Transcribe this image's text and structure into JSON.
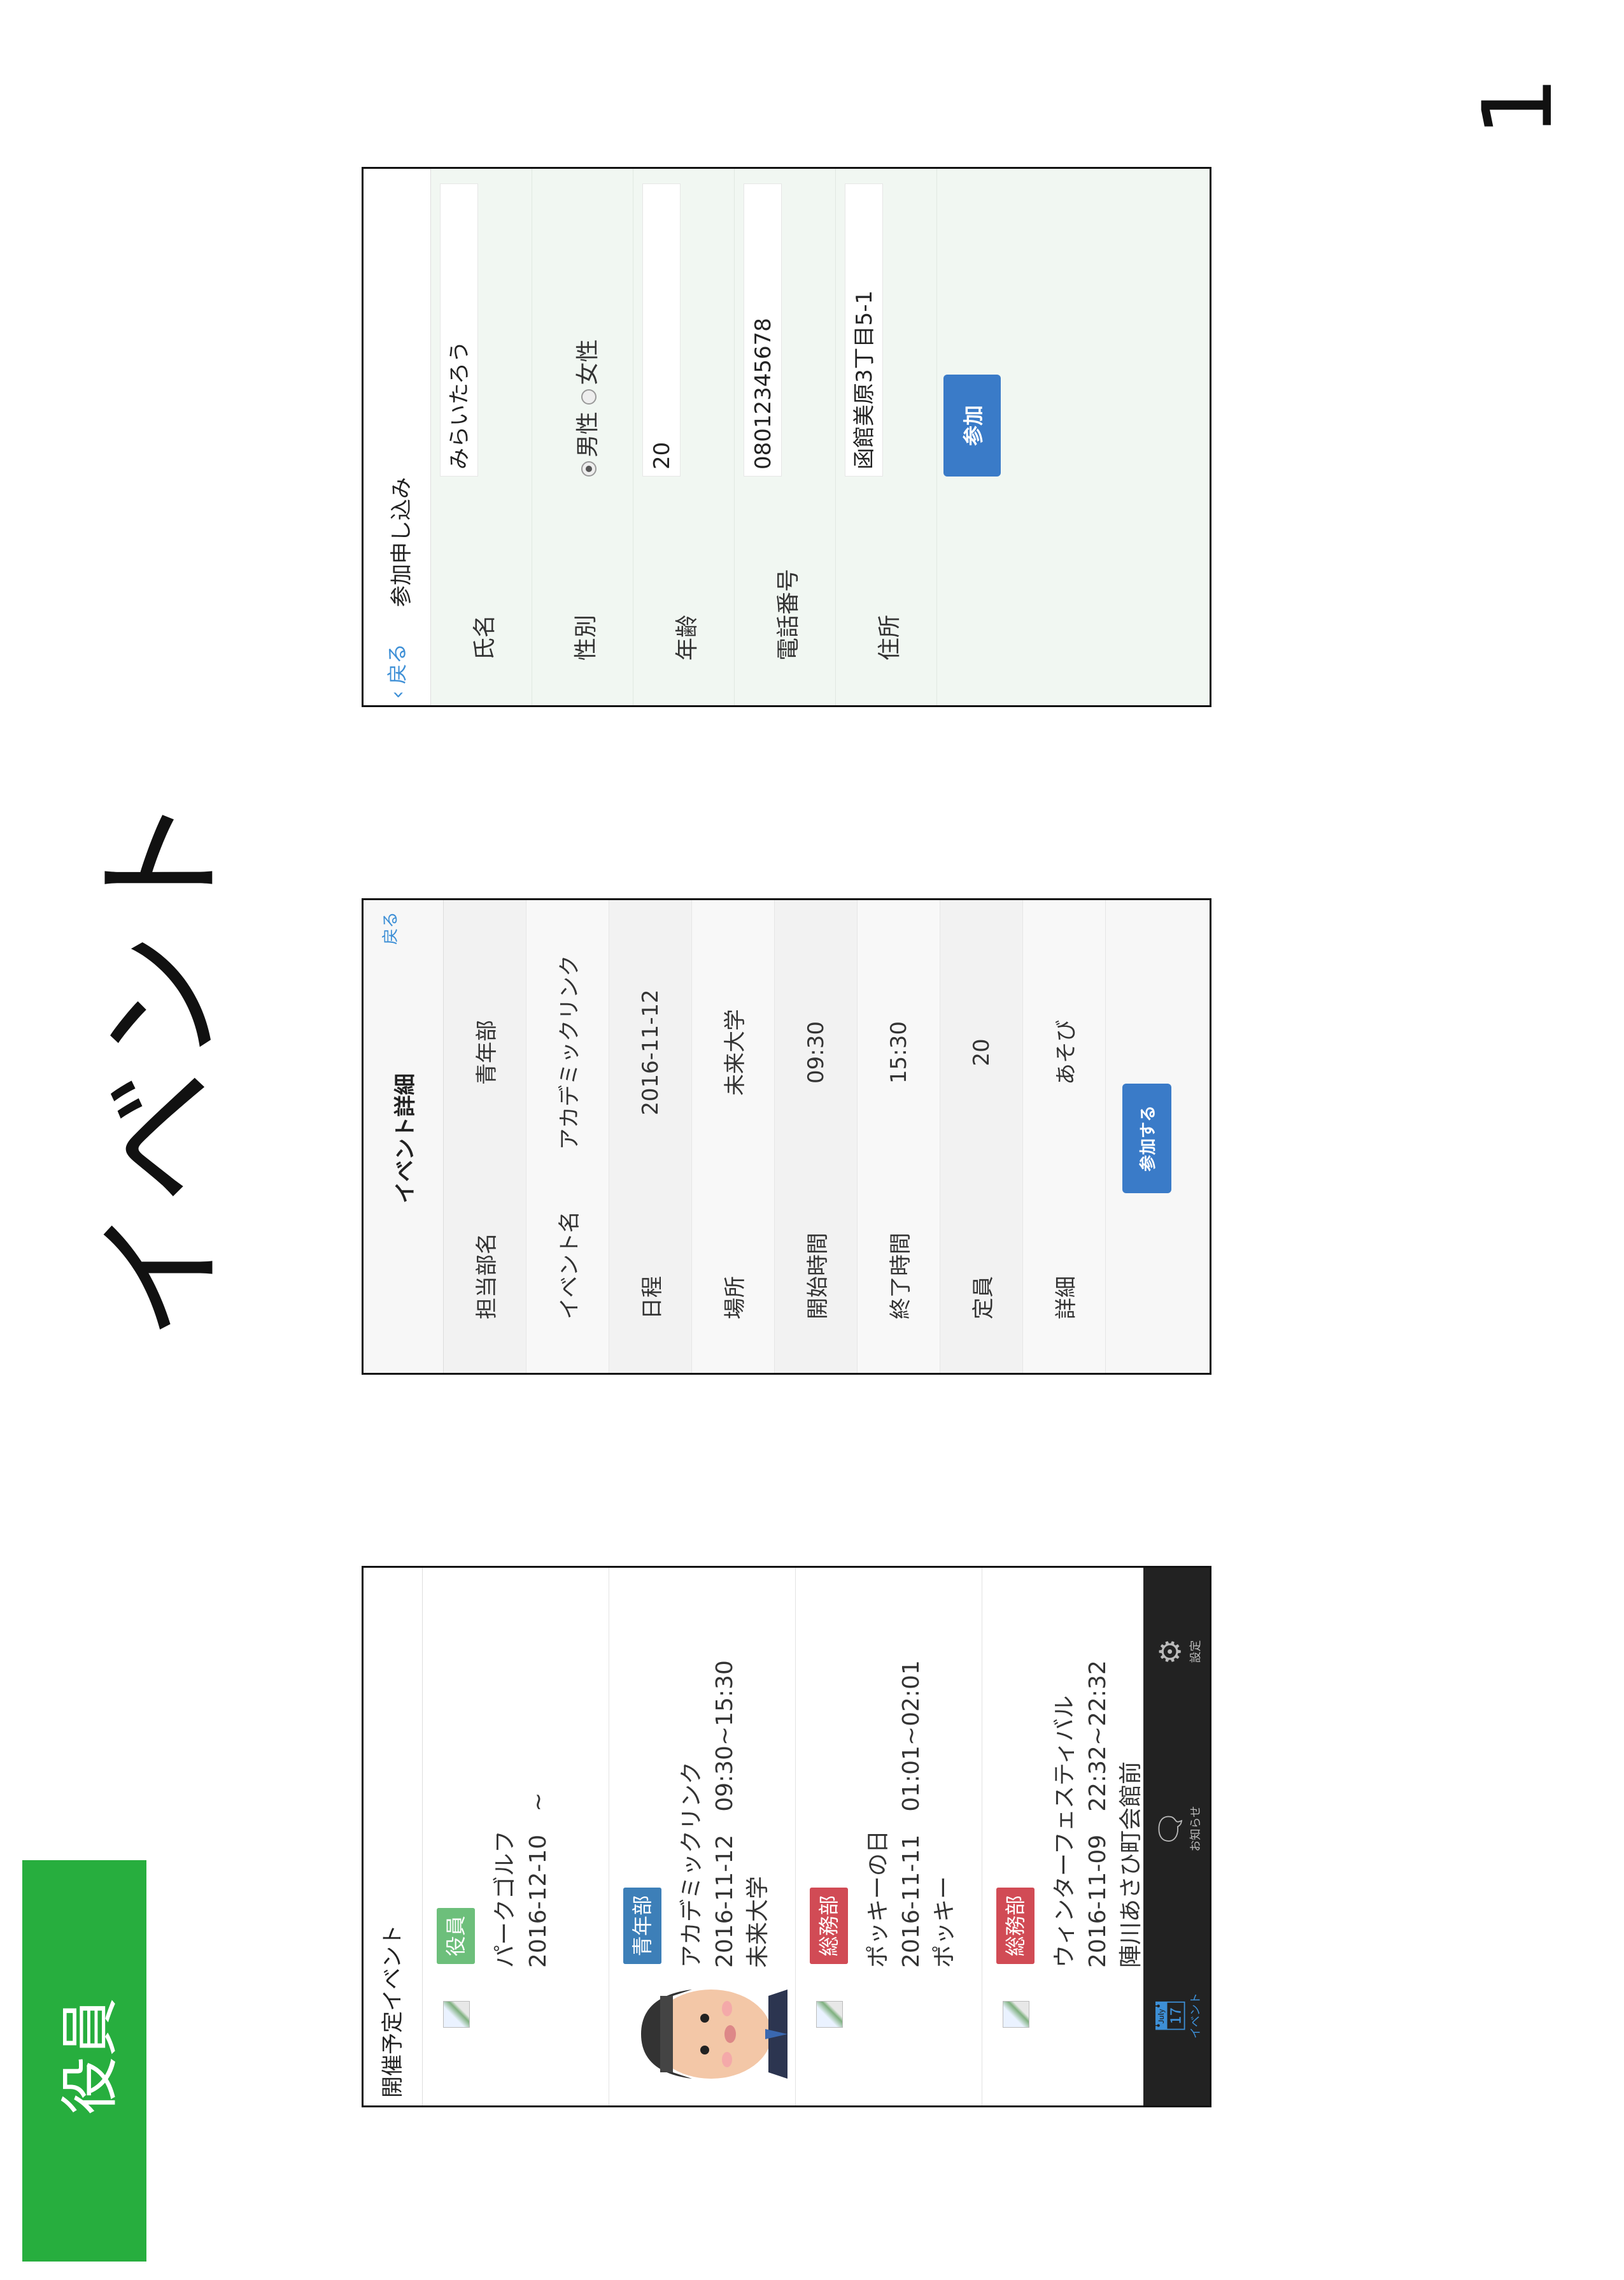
{
  "slide": {
    "role_label": "役員",
    "title": "イベント",
    "page_number": "1"
  },
  "colors": {
    "role_badge": "#27ae3e",
    "accent_blue": "#3a7bc8",
    "tag_role": "#6dbf7b",
    "tag_youth": "#3d7fb8",
    "tag_general": "#d14b55"
  },
  "list_screen": {
    "header": "開催予定イベント",
    "items": [
      {
        "tag": "役員",
        "tag_color": "#6dbf7b",
        "name": "パークゴルフ",
        "schedule": "2016-12-10　~",
        "place": "",
        "has_avatar": false
      },
      {
        "tag": "青年部",
        "tag_color": "#3d7fb8",
        "name": "アカデミックリンク",
        "schedule": "2016-11-12　09:30~15:30",
        "place": "未来大学",
        "has_avatar": true
      },
      {
        "tag": "総務部",
        "tag_color": "#d14b55",
        "name": "ポッキーの日",
        "schedule": "2016-11-11　01:01~02:01",
        "place": "ポッキー",
        "has_avatar": false
      },
      {
        "tag": "総務部",
        "tag_color": "#d14b55",
        "name": "ウィンターフェスティバル",
        "schedule": "2016-11-09　22:32~22:32",
        "place": "陣川あさひ町会館前",
        "has_avatar": false
      }
    ],
    "tabs": [
      {
        "icon": "calendar-icon",
        "label": "イベント",
        "active": true
      },
      {
        "icon": "chat-icon",
        "label": "お知らせ",
        "active": false
      },
      {
        "icon": "gear-icon",
        "label": "設定",
        "active": false
      }
    ]
  },
  "detail_screen": {
    "title": "イベント詳細",
    "back": "戻る",
    "rows": [
      {
        "label": "担当部名",
        "value": "青年部"
      },
      {
        "label": "イベント名",
        "value": "アカデミックリンク"
      },
      {
        "label": "日程",
        "value": "2016-11-12"
      },
      {
        "label": "場所",
        "value": "未来大学"
      },
      {
        "label": "開始時間",
        "value": "09:30"
      },
      {
        "label": "終了時間",
        "value": "15:30"
      },
      {
        "label": "定員",
        "value": "20"
      },
      {
        "label": "詳細",
        "value": "あそび"
      }
    ],
    "join_button": "参加する"
  },
  "form_screen": {
    "back": "戻る",
    "title": "参加申し込み",
    "fields": {
      "name": {
        "label": "氏名",
        "value": "みらいたろう"
      },
      "gender": {
        "label": "性別",
        "options": [
          "男性",
          "女性"
        ],
        "selected": "男性"
      },
      "age": {
        "label": "年齢",
        "value": "20"
      },
      "phone": {
        "label": "電話番号",
        "value": "08012345678"
      },
      "address": {
        "label": "住所",
        "value": "函館美原3丁目5-1"
      }
    },
    "submit": "参加"
  }
}
